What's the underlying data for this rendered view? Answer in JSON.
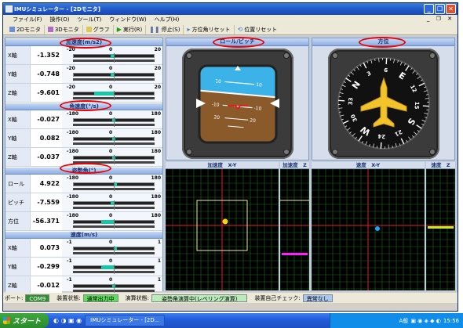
{
  "window": {
    "title": "IMUシミュレーター - [2Dモニタ]"
  },
  "menu": [
    "ファイル(F)",
    "操作(O)",
    "ツール(T)",
    "ウィンドウ(W)",
    "ヘルプ(H)"
  ],
  "toolbar": {
    "b2d": "2Dモニタ",
    "b3d": "3Dモニタ",
    "graph": "グラフ",
    "run": "実行(R)",
    "stop": "停止(S)",
    "dir_reset": "方位角リセット",
    "pos_reset": "位置リセット"
  },
  "sections": {
    "accel": {
      "title": "加速度(m/s2)",
      "scale": [
        "-20",
        "0",
        "20"
      ],
      "rows": [
        {
          "label": "X軸",
          "value": "-1.352",
          "frac": -0.068
        },
        {
          "label": "Y軸",
          "value": "-0.748",
          "frac": -0.037
        },
        {
          "label": "Z軸",
          "value": "-9.601",
          "frac": -0.48
        }
      ]
    },
    "gyro": {
      "title": "角速度(°/s)",
      "scale": [
        "-180",
        "0",
        "180"
      ],
      "rows": [
        {
          "label": "X軸",
          "value": "-0.027",
          "frac": 0
        },
        {
          "label": "Y軸",
          "value": "0.082",
          "frac": 0
        },
        {
          "label": "Z軸",
          "value": "-0.037",
          "frac": 0
        }
      ]
    },
    "attitude": {
      "title": "姿勢角(°)",
      "scale": [
        "-180",
        "0",
        "180"
      ],
      "rows": [
        {
          "label": "ロール",
          "value": "4.922",
          "frac": 0.027
        },
        {
          "label": "ピッチ",
          "value": "-7.559",
          "frac": -0.042
        },
        {
          "label": "方位",
          "value": "-56.371",
          "frac": -0.313
        }
      ]
    },
    "velocity": {
      "title": "速度(m/s)",
      "scale": [
        "-1",
        "0",
        "1"
      ],
      "rows": [
        {
          "label": "X軸",
          "value": "0.073",
          "frac": 0.073
        },
        {
          "label": "Y軸",
          "value": "-0.299",
          "frac": -0.299
        },
        {
          "label": "Z軸",
          "value": "-0.012",
          "frac": 0
        }
      ]
    }
  },
  "panels": {
    "rollpitch": "ロール/ピッチ",
    "heading": "方位",
    "g_accel_xy": "加速度　X-Y",
    "g_accel_z": "加速度　Z",
    "g_vel_xy": "速度　X-Y",
    "g_vel_z": "速度　Z"
  },
  "attitude_indicator": {
    "labels": [
      "10",
      "10",
      "-10",
      "-10",
      "20",
      "20"
    ]
  },
  "compass": {
    "labels": [
      "N",
      "3",
      "6",
      "E",
      "12",
      "15",
      "S",
      "21",
      "24",
      "W",
      "30",
      "33"
    ]
  },
  "status": {
    "port_label": "ポート:",
    "port": "COM9",
    "dev_label": "装置状態:",
    "dev": "通常出力中",
    "calc_label": "演算状態:",
    "calc": "姿勢角演算中(レベリング演算)",
    "self_label": "装置自己チェック:",
    "self": "異常なし"
  },
  "taskbar": {
    "start": "スタート",
    "task": "IMUシミュレーター - [2D...",
    "clock": "15:56",
    "ime": "A般"
  }
}
